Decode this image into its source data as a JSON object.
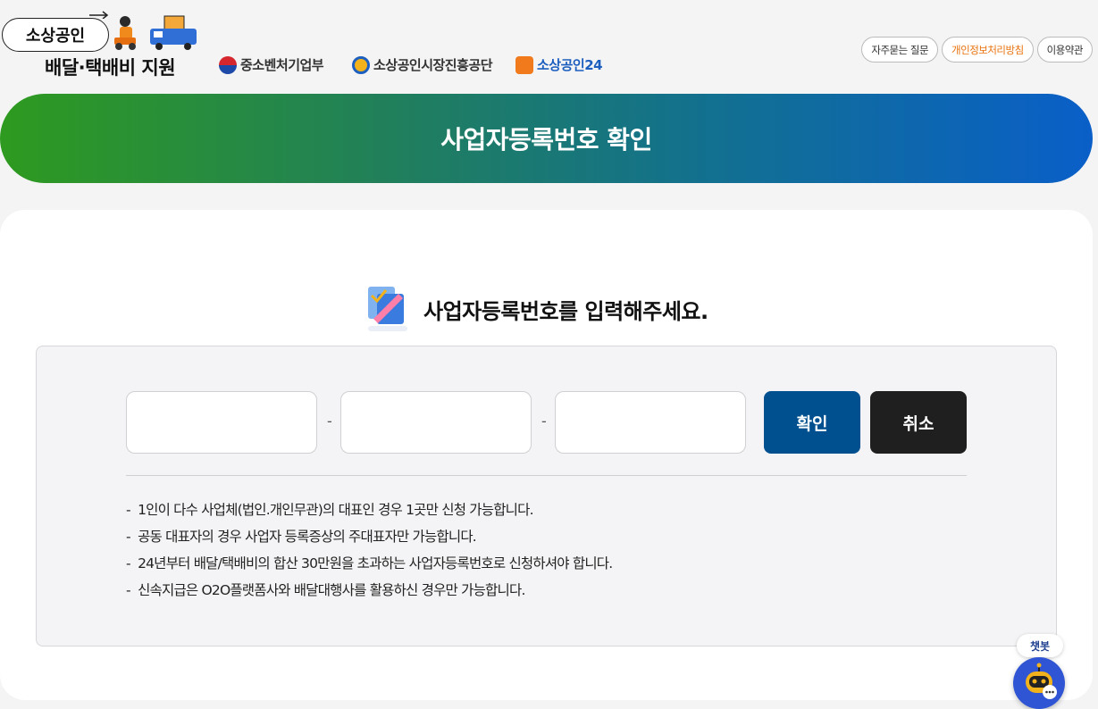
{
  "header": {
    "logo_title": "소상공인",
    "logo_subtitle": "배달·택배비 지원",
    "orgs": [
      "중소벤처기업부",
      "소상공인시장진흥공단",
      "소상공인24"
    ],
    "links": [
      "자주묻는 질문",
      "개인정보처리방침",
      "이용약관"
    ]
  },
  "banner": {
    "title": "사업자등록번호 확인"
  },
  "card": {
    "heading": "사업자등록번호를 입력해주세요.",
    "separator": "-",
    "confirm_label": "확인",
    "cancel_label": "취소",
    "notes": [
      "1인이 다수 사업체(법인.개인무관)의 대표인 경우 1곳만 신청 가능합니다.",
      "공동 대표자의 경우 사업자 등록증상의 주대표자만 가능합니다.",
      "24년부터 배달/택배비의 합산 30만원을 초과하는 사업자등록번호로 신청하셔야 합니다.",
      "신속지급은 O2O플랫폼사와 배달대행사를 활용하신 경우만 가능합니다."
    ]
  },
  "chatbot": {
    "label": "챗봇"
  },
  "colors": {
    "confirm": "#00508f",
    "cancel": "#1f1f1f",
    "accent_link": "#e8730e",
    "chatbot": "#2f55d4"
  }
}
